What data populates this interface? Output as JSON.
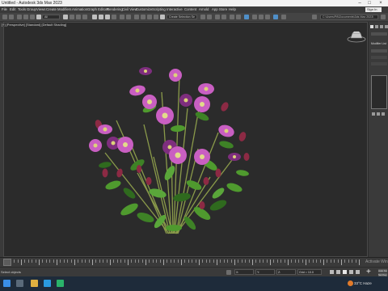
{
  "window": {
    "title": "Untitled - Autodesk 3ds Max 2023"
  },
  "menus": [
    "File",
    "Edit",
    "Tools",
    "Group",
    "Views",
    "Create",
    "Modifiers",
    "Animation",
    "Graph Editors",
    "Rendering",
    "Civil View",
    "Customize",
    "Scripting",
    "Interactive",
    "Content",
    "Arnold",
    "App Store",
    "Help"
  ],
  "signin": "Sign In",
  "toolbar": {
    "filter": "All",
    "selection_set": "Create Selection Se",
    "path": "C:\\Users\\PA\\Documents\\3ds Max 2023\\"
  },
  "viewport": {
    "label": "[+] [Perspective] [Standard] [Default Shading]"
  },
  "command_panel": {
    "label": "Modifier List"
  },
  "timeline": {
    "watermark": "Activate Win"
  },
  "status": {
    "text": "Select objects",
    "x_field": "X:",
    "y_field": "Y:",
    "z_field": "Z:",
    "grid": "Grid = 10.0",
    "time_tag": "Add Time Tag",
    "auto_key": "Auto Key",
    "set_key": "Set Key",
    "frame": "0"
  },
  "taskbar": {
    "weather": "33°C Haze"
  },
  "colors": {
    "petal": "#c95fc2",
    "petal_dark": "#7e2e7e",
    "bud": "#8c2a44",
    "leaf": "#4f9a2e",
    "leaf_dark": "#2f6a1e",
    "stem": "#8a9a4a"
  },
  "icons": [
    "max-logo-icon",
    "minimize-icon",
    "maximize-icon",
    "close-icon",
    "undo-icon",
    "redo-icon",
    "link-icon",
    "select-icon",
    "move-icon",
    "rotate-icon",
    "scale-icon",
    "snap-icon",
    "render-icon",
    "viewcube-icon",
    "create-icon",
    "modify-icon",
    "hierarchy-icon",
    "motion-icon",
    "display-icon",
    "utilities-icon",
    "play-icon",
    "key-icon",
    "search-icon",
    "windows-icon",
    "explorer-icon",
    "edge-icon",
    "3dsmax-icon",
    "weather-icon"
  ]
}
